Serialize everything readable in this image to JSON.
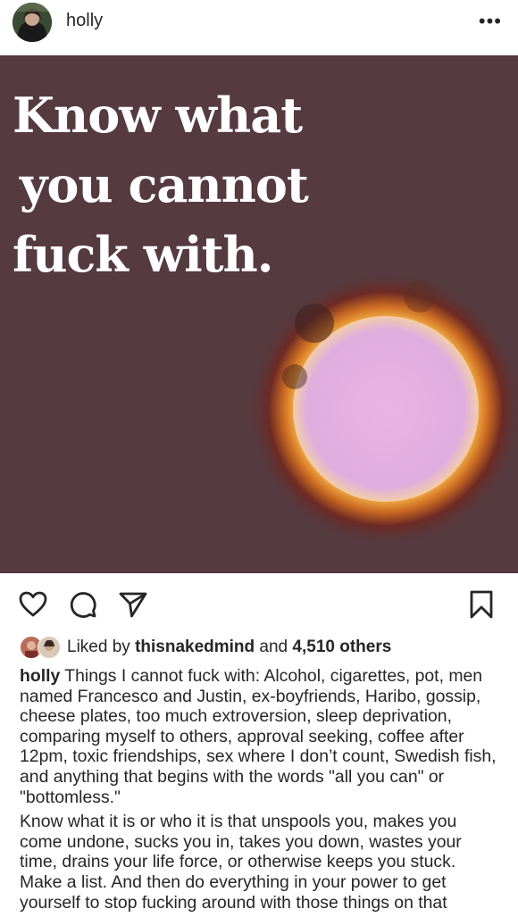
{
  "header": {
    "username": "holly",
    "more_icon": "more-horizontal-icon"
  },
  "post": {
    "headline": [
      "Know what",
      "you cannot",
      "fuck with."
    ],
    "background_color": "#553a40",
    "headline_color": "#ffffff"
  },
  "actions": {
    "like_icon": "heart-icon",
    "comment_icon": "comment-icon",
    "share_icon": "send-icon",
    "save_icon": "bookmark-icon"
  },
  "likes": {
    "prefix": "Liked by",
    "user": "thisnakedmind",
    "joiner": "and",
    "others": "4,510 others"
  },
  "caption": {
    "username": "holly",
    "paragraph1": "Things I cannot fuck with: Alcohol, cigarettes, pot, men named Francesco and Justin, ex-boyfriends, Haribo, gossip, cheese plates, too much extroversion, sleep deprivation, comparing myself to others, approval seeking, coffee after 12pm, toxic friendships, sex where I don’t count, Swedish fish, and anything that begins with the words \"all you can\" or \"bottomless.\"",
    "paragraph2": "Know what it is or who it is that unspools you, makes you come undone, sucks you in, takes you down, wastes your time, drains your life force, or otherwise keeps you stuck. Make a list. And then do everything in your power to get yourself to stop fucking around with those things on that"
  }
}
